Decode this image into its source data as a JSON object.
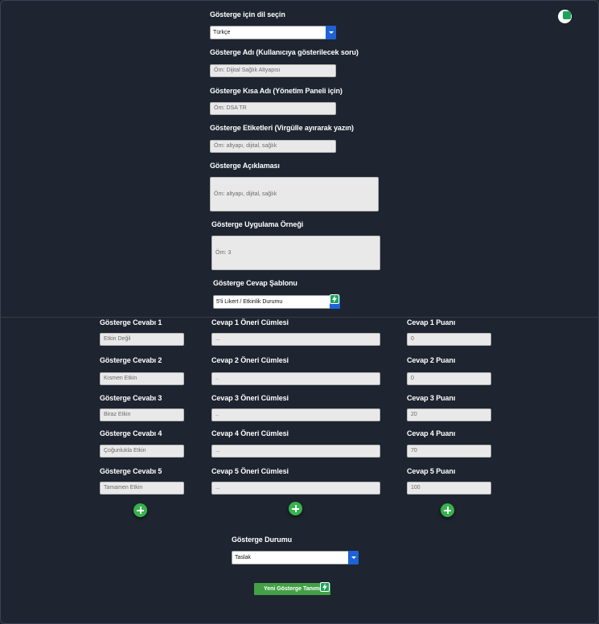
{
  "language": {
    "label": "Gösterge için dil seçin",
    "selected": "Türkçe"
  },
  "indicator_name": {
    "label": "Gösterge Adı (Kullanıcıya gösterilecek soru)",
    "placeholder": "Örn: Dijital Sağlık Altyapısı"
  },
  "short_name": {
    "label": "Gösterge Kısa Adı (Yönetim Paneli için)",
    "placeholder": "Örn: DSA TR"
  },
  "tags": {
    "label": "Gösterge Etiketleri (Virgülle ayırarak yazın)",
    "placeholder": "Örn: altyapı, dijital, sağlık"
  },
  "description": {
    "label": "Gösterge Açıklaması",
    "placeholder": "Örn: altyapı, dijital, sağlık"
  },
  "example": {
    "label": "Gösterge Uygulama Örneği",
    "placeholder": "Örn: 3"
  },
  "answer_template": {
    "label": "Gösterge Cevap Şablonu",
    "selected": "5'li Likert / Etkinlik Durumu"
  },
  "answers": [
    {
      "label": "Gösterge Cevabı 1",
      "value": "Etkin Değil",
      "sentence_label": "Cevap 1 Öneri Cümlesi",
      "sentence": "...",
      "score_label": "Cevap 1 Puanı",
      "score": "0"
    },
    {
      "label": "Gösterge Cevabı 2",
      "value": "Kısmen Etkin",
      "sentence_label": "Cevap 2 Öneri Cümlesi",
      "sentence": "..",
      "score_label": "Cevap 2 Puanı",
      "score": "0"
    },
    {
      "label": "Gösterge Cevabı 3",
      "value": "Biraz Etkin",
      "sentence_label": "Cevap 3 Öneri Cümlesi",
      "sentence": "..",
      "score_label": "Cevap 3 Puanı",
      "score": "20"
    },
    {
      "label": "Gösterge Cevabı 4",
      "value": "Çoğunlukla Etkin",
      "sentence_label": "Cevap 4 Öneri Cümlesi",
      "sentence": "...",
      "score_label": "Cevap 4 Puanı",
      "score": "70"
    },
    {
      "label": "Gösterge Cevabı 5",
      "value": "Tamamen Etkin",
      "sentence_label": "Cevap 5 Öneri Cümlesi",
      "sentence": "...",
      "score_label": "Cevap 5 Puanı",
      "score": "100"
    }
  ],
  "status": {
    "label": "Gösterge Durumu",
    "selected": "Taslak"
  },
  "submit_label": "Yeni Gösterge Tanımı",
  "icons": {
    "top_right": "extension-bolt-icon",
    "field": "lightning-badge-icon",
    "add": "plus-circle-icon"
  },
  "colors": {
    "background": "#1e2530",
    "accent_blue": "#1e63d6",
    "add_green": "#37b24d",
    "submit_green": "#43a047"
  }
}
